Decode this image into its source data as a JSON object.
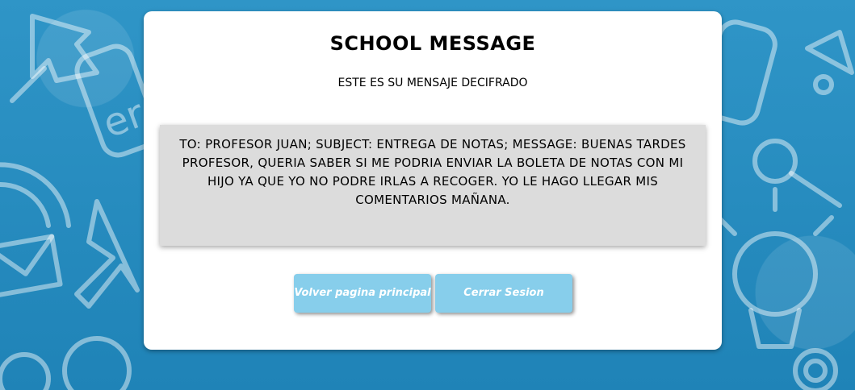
{
  "page": {
    "title": "SCHOOL MESSAGE",
    "subtitle": "ESTE ES SU MENSAJE DECIFRADO",
    "message": "TO: PROFESOR JUAN; SUBJECT: ENTREGA DE NOTAS; MESSAGE: BUENAS TARDES PROFESOR, QUERIA SABER SI ME PODRIA ENVIAR LA BOLETA DE NOTAS CON MI HIJO YA QUE YO NO PODRE IRLAS A RECOGER. YO LE HAGO LLEGAR MIS COMENTARIOS MAÑANA."
  },
  "buttons": {
    "home_label": "Volver pagina principal",
    "logout_label": "Cerrar Sesion"
  },
  "colors": {
    "background": "#2a8cbf",
    "card": "#ffffff",
    "message_box": "#dcdcdc",
    "button": "#87ceeb",
    "button_text": "#ffffff"
  },
  "icons": [
    "pin-icon",
    "enter-key-icon",
    "wifi-icon",
    "cursor-arrow-icon",
    "envelope-icon",
    "lightbulb-icon",
    "magnifier-icon",
    "bell-icon"
  ]
}
